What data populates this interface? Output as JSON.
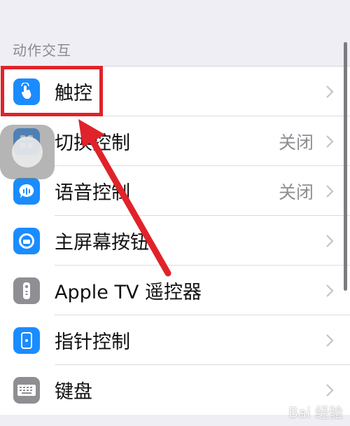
{
  "section": {
    "header": "动作交互"
  },
  "rows": [
    {
      "label": "触控",
      "value": "",
      "icon": "touch-hand-icon",
      "color": "#1a8cff"
    },
    {
      "label": "切换控制",
      "value": "关闭",
      "icon": "switch-grid-icon",
      "color": "#1a8cff"
    },
    {
      "label": "语音控制",
      "value": "关闭",
      "icon": "voice-control-icon",
      "color": "#1a8cff"
    },
    {
      "label": "主屏幕按钮",
      "value": "",
      "icon": "home-button-icon",
      "color": "#1a8cff"
    },
    {
      "label": "Apple TV 遥控器",
      "value": "",
      "icon": "remote-icon",
      "color": "#8e8e93"
    },
    {
      "label": "指针控制",
      "value": "",
      "icon": "pointer-control-icon",
      "color": "#1a8cff"
    },
    {
      "label": "键盘",
      "value": "",
      "icon": "keyboard-icon",
      "color": "#8e8e93"
    }
  ],
  "annotation": {
    "color": "#e0232a"
  },
  "watermark": "Bai 经验"
}
